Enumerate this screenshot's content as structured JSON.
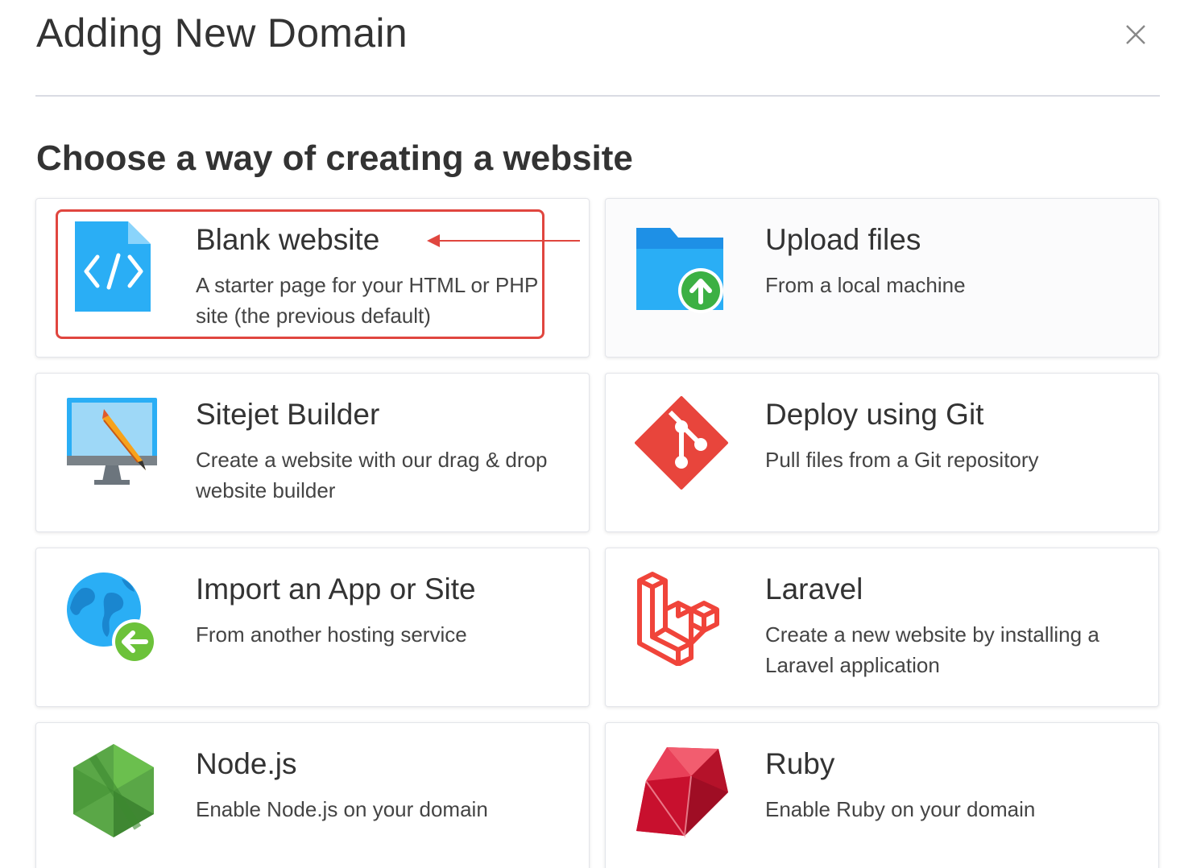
{
  "dialog": {
    "title": "Adding New Domain",
    "close_icon": "close-icon"
  },
  "subtitle": "Choose a way of creating a website",
  "options": [
    {
      "title": "Blank website",
      "description": "A starter page for your HTML or PHP site (the previous default)",
      "icon": "code-file-icon",
      "highlighted": true
    },
    {
      "title": "Upload files",
      "description": "From a local machine",
      "icon": "folder-upload-icon"
    },
    {
      "title": "Sitejet Builder",
      "description": "Create a website with our drag & drop website builder",
      "icon": "monitor-pencil-icon"
    },
    {
      "title": "Deploy using Git",
      "description": "Pull files from a Git repository",
      "icon": "git-icon"
    },
    {
      "title": "Import an App or Site",
      "description": "From another hosting service",
      "icon": "globe-import-icon"
    },
    {
      "title": "Laravel",
      "description": "Create a new website by installing a Laravel application",
      "icon": "laravel-icon"
    },
    {
      "title": "Node.js",
      "description": "Enable Node.js on your domain",
      "icon": "nodejs-icon"
    },
    {
      "title": "Ruby",
      "description": "Enable Ruby on your domain",
      "icon": "ruby-icon"
    }
  ],
  "colors": {
    "highlight": "#e0463f",
    "accent_blue": "#2aaef5",
    "git_red": "#e8453c",
    "laravel_red": "#f0443a",
    "node_green": "#5aa747",
    "ruby_red": "#c8102e"
  }
}
